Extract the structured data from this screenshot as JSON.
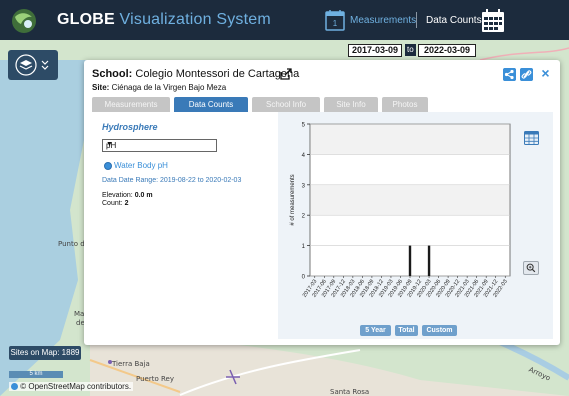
{
  "app": {
    "title_main": "GLOBE",
    "title_sub": "Visualization System",
    "measurements_label": "Measurements",
    "data_counts_label": "Data Counts",
    "logo_icon": "globe-logo-icon"
  },
  "dates": {
    "start": "2017-03-09",
    "to": "to",
    "end": "2022-03-09"
  },
  "map": {
    "sites_on_map": "Sites on Map: 1889",
    "scale": "5 km",
    "attribution": "© OpenStreetMap contributors.",
    "labels": [
      "Punto d",
      "Mar",
      "de",
      "Tierra Baja",
      "Puerto Rey",
      "Santa Rosa",
      "Arroyo"
    ]
  },
  "dialog": {
    "school_label": "School:",
    "school_name": "Colegio Montessori de Cartagena",
    "site_label": "Site:",
    "site_name": "Ciénaga de la Virgen Bajo Meza",
    "tabs": [
      {
        "label": "Measurements",
        "active": false
      },
      {
        "label": "Data Counts",
        "active": true
      },
      {
        "label": "School Info",
        "active": false
      },
      {
        "label": "Site Info",
        "active": false
      },
      {
        "label": "Photos",
        "active": false
      }
    ],
    "close_glyph": "×"
  },
  "panel": {
    "category": "Hydrosphere",
    "select_value": "pH",
    "radio_label": "Water Body pH",
    "range_label": "Data Date Range:",
    "range_value": "2019-08-22 to 2020-02-03",
    "elevation_label": "Elevation:",
    "elevation_value": "0.0 m",
    "count_label": "Count:",
    "count_value": "2",
    "range_buttons": [
      "5 Year",
      "Total",
      "Custom"
    ]
  },
  "colors": {
    "header_bg": "#1c2b3d",
    "accent_blue": "#3a7ab8",
    "link_blue": "#3a8fd8",
    "bar": "#1a1a1a"
  },
  "chart_data": {
    "type": "bar",
    "ylabel": "# of measurements",
    "ylim": [
      0,
      5
    ],
    "yticks": [
      0,
      1,
      2,
      3,
      4,
      5
    ],
    "categories": [
      "2017-03",
      "2017-06",
      "2017-09",
      "2017-12",
      "2018-03",
      "2018-06",
      "2018-09",
      "2018-12",
      "2019-03",
      "2019-06",
      "2019-09",
      "2019-12",
      "2020-03",
      "2020-06",
      "2020-09",
      "2020-12",
      "2021-03",
      "2021-06",
      "2021-09",
      "2021-12",
      "2022-03"
    ],
    "values": [
      0,
      0,
      0,
      0,
      0,
      0,
      0,
      0,
      0,
      0,
      1,
      0,
      1,
      0,
      0,
      0,
      0,
      0,
      0,
      0,
      0
    ],
    "grid": true,
    "legend": "none"
  }
}
